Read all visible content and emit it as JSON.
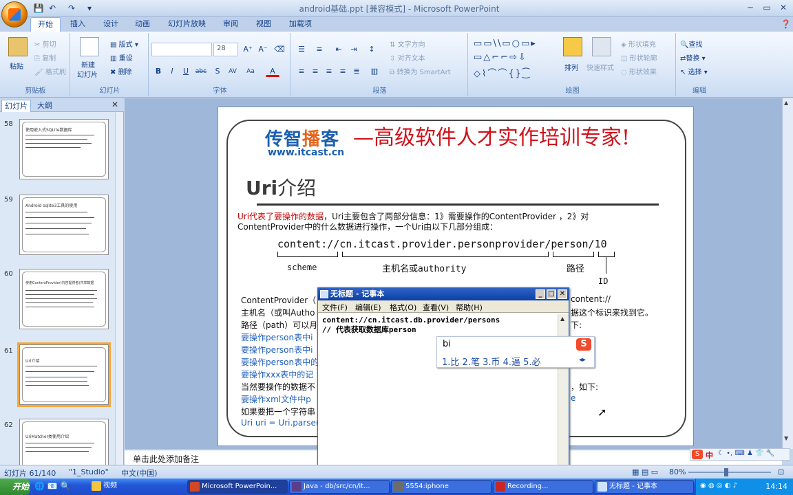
{
  "window": {
    "title": "android基础.ppt [兼容模式] - Microsoft PowerPoint"
  },
  "tabs": [
    "开始",
    "插入",
    "设计",
    "动画",
    "幻灯片放映",
    "审阅",
    "视图",
    "加载项"
  ],
  "ribbon": {
    "clipboard": {
      "label": "剪贴板",
      "paste": "粘贴",
      "cut": "剪切",
      "copy": "复制",
      "format_painter": "格式刷"
    },
    "slides": {
      "label": "幻灯片",
      "new_slide": "新建\n幻灯片",
      "new_line1": "新建",
      "new_line2": "幻灯片",
      "layout": "版式",
      "reset": "重设",
      "delete": "删除"
    },
    "font": {
      "label": "字体",
      "size": "28"
    },
    "paragraph": {
      "label": "段落",
      "text_direction": "文字方向",
      "align_text": "对齐文本",
      "smartart": "转换为 SmartArt"
    },
    "drawing": {
      "label": "绘图",
      "arrange": "排列",
      "quick_styles": "快速样式",
      "shape_fill": "形状填充",
      "shape_outline": "形状轮廓",
      "shape_effects": "形状效果"
    },
    "editing": {
      "label": "编辑",
      "find": "查找",
      "replace": "替换",
      "select": "选择"
    }
  },
  "left_pane": {
    "tabs": [
      "幻灯片",
      "大纲"
    ],
    "thumbnails": [
      {
        "num": "58",
        "title": "使用嵌入式SQLite数据库"
      },
      {
        "num": "59",
        "title": "Android sqlite3工具的使用"
      },
      {
        "num": "60",
        "title": "使用ContentProvider(内容提供者)共享数据"
      },
      {
        "num": "61",
        "title": "Uri介绍",
        "selected": true
      },
      {
        "num": "62",
        "title": "UriMatcher类使用介绍"
      }
    ]
  },
  "slide": {
    "brand_name": "传智播客",
    "brand_name_pre": "传智",
    "brand_name_hl": "播",
    "brand_name_post": "客",
    "brand_url": "www.itcast.cn",
    "slogan": "—高级软件人才实作培训专家!",
    "heading_bold": "Uri",
    "heading_rest": "介绍",
    "para1_red": "Uri代表了要操作的数据",
    "para1_rest": "，Uri主要包含了两部分信息：1》需要操作的ContentProvider ，2》对",
    "para1_line2": "ContentProvider中的什么数据进行操作，一个Uri由以下几部分组成：",
    "uri_example": "content://cn.itcast.provider.personprovider/person/10",
    "label_scheme": "scheme",
    "label_authority": "主机名或authority",
    "label_path": "路径",
    "label_id": "ID",
    "lines": [
      {
        "text": "ContentProvider（",
        "tail": "content://",
        "color": "black"
      },
      {
        "text": "主机名（或叫Autho",
        "tail": "据这个标识来找到它。",
        "color": "black"
      },
      {
        "text": "路径（path）可以月",
        "tail": "下:",
        "color": "black"
      },
      {
        "text": "要操作person表中i",
        "tail": "",
        "color": "blue"
      },
      {
        "text": "要操作person表中i",
        "tail": "",
        "color": "blue"
      },
      {
        "text": "要操作person表中的",
        "tail": "",
        "color": "blue"
      },
      {
        "text": "要操作xxx表中的记",
        "tail": "",
        "color": "blue"
      },
      {
        "text": "当然要操作的数据不",
        "tail": "，如下:",
        "color": "black"
      },
      {
        "text": "要操作xml文件中p",
        "tail": "e",
        "color": "blue"
      },
      {
        "text": "如果要把一个字符串",
        "tail": "",
        "color": "black"
      },
      {
        "text": "Uri uri = Uri.parse(\"",
        "tail": "",
        "color": "blue"
      }
    ]
  },
  "notes": {
    "placeholder": "单击此处添加备注"
  },
  "notepad": {
    "title": "无标题 - 记事本",
    "menu": [
      "文件(F)",
      "编辑(E)",
      "格式(O)",
      "查看(V)",
      "帮助(H)"
    ],
    "body_line1": "content://cn.itcast.db.provider/persons",
    "body_line2": "// 代表获取数据库person"
  },
  "ime": {
    "input": "bi",
    "candidates": "1.比  2.笔  3.币  4.逼  5.必"
  },
  "statusbar": {
    "slide_pos": "幻灯片 61/140",
    "theme": "\"1_Studio\"",
    "language": "中文(中国)",
    "zoom": "80%"
  },
  "taskbar": {
    "start": "开始",
    "items": [
      "视频",
      "Microsoft PowerPoin...",
      "Java - db/src/cn/it...",
      "5554:iphone",
      "Recording...",
      "无标题 - 记事本"
    ],
    "ime_tray": "中",
    "clock": "14:14"
  },
  "colors": {
    "accent": "#15428b",
    "slogan": "#d0121b",
    "brand_blue": "#1c5fb0",
    "brand_orange": "#e8651e",
    "selection": "#f7a93c"
  }
}
